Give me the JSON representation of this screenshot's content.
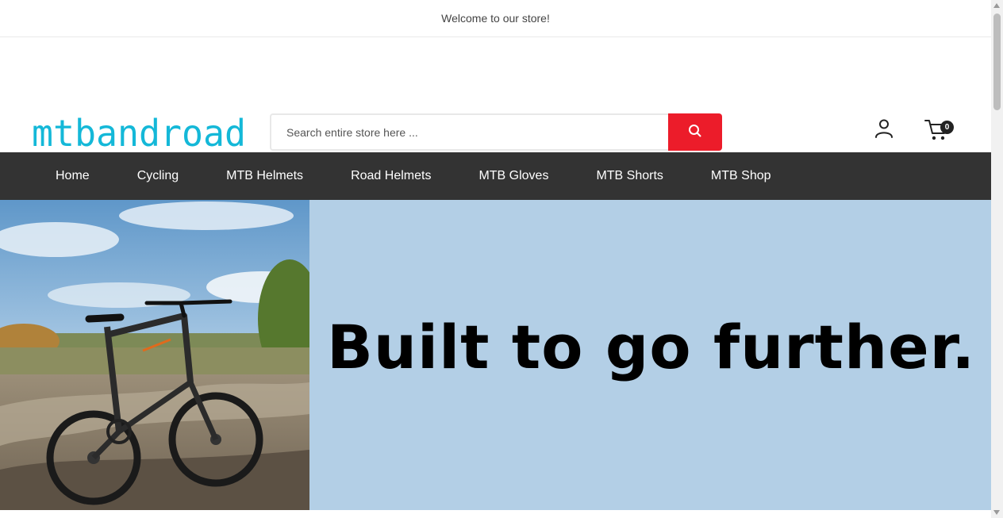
{
  "topbar": {
    "welcome_text": "Welcome to our store!"
  },
  "header": {
    "logo_text": "mtbandroad",
    "search": {
      "placeholder": "Search entire store here ...",
      "value": "",
      "button_icon": "search-icon"
    },
    "account_icon": "user-icon",
    "cart": {
      "icon": "cart-icon",
      "count": "0"
    }
  },
  "nav": {
    "items": [
      {
        "label": "Home"
      },
      {
        "label": "Cycling"
      },
      {
        "label": "MTB Helmets"
      },
      {
        "label": "Road Helmets"
      },
      {
        "label": "MTB Gloves"
      },
      {
        "label": "MTB Shorts"
      },
      {
        "label": "MTB Shop"
      }
    ]
  },
  "hero": {
    "heading": "Built to go further."
  },
  "colors": {
    "logo": "#14b8d8",
    "search_button": "#ec1c2a",
    "nav_background": "#333333",
    "hero_background": "#b3cfe6"
  }
}
